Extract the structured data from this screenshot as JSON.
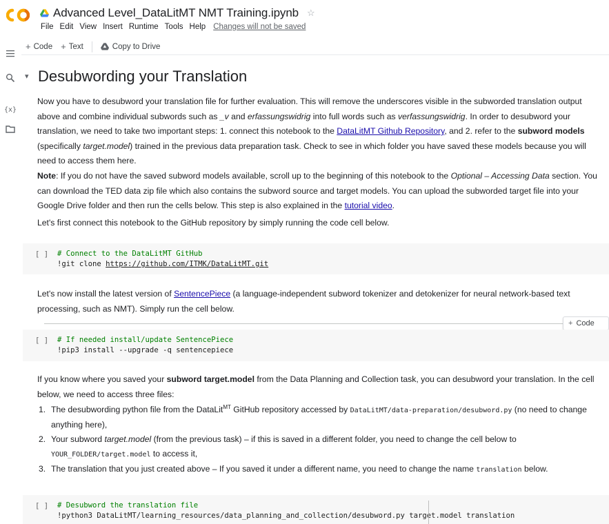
{
  "header": {
    "title": "Advanced Level_DataLitMT NMT Training.ipynb",
    "menu": [
      "File",
      "Edit",
      "View",
      "Insert",
      "Runtime",
      "Tools",
      "Help"
    ],
    "unsaved_notice": "Changes will not be saved"
  },
  "toolbar": {
    "add_code": "Code",
    "add_text": "Text",
    "copy_to_drive": "Copy to Drive"
  },
  "sidebar_icons": [
    "table-of-contents-icon",
    "search-icon",
    "variables-icon",
    "files-icon"
  ],
  "section": {
    "heading": "Desubwording your Translation",
    "para1": {
      "t1": "Now you have to desubword your translation file for further evaluation. This will remove the underscores visible in the subworded translation output above and combine individual subwords such as ",
      "em1": "_v",
      "t2": " and ",
      "em2": "erfassungswidrig",
      "t3": " into full words such as ",
      "em3": "verfassungswidrig",
      "t4": ". In order to desubword your translation, we need to take two important steps: 1. connect this notebook to the ",
      "link": "DataLitMT Github Repository",
      "t5": ", and 2. refer to the ",
      "b1": "subword models",
      "t6": " (specifically ",
      "em4": "target.model",
      "t7": ") trained in the previous data preparation task. Check to see in which folder you have saved these models because you will need to access them here."
    },
    "para2": {
      "b1": "Note",
      "t1": ": If you do not have the saved subword models available, scroll up to the beginning of this notebook to the ",
      "em1": "Optional – Accessing Data",
      "t2": " section. You can download the TED data zip file which also contains the subword source and target models. You can upload the subworded target file into your Google Drive folder and then run the cells below. This step is also explained in the ",
      "link": "tutorial video",
      "t3": "."
    },
    "para3": "Let's first connect this notebook to the GitHub repository by simply running the code cell below.",
    "cell1": {
      "run": "[ ]",
      "comment": "# Connect to the DataLitMT GitHub",
      "cmd": "!git clone ",
      "url": "https://github.com/ITMK/DataLitMT.git"
    },
    "para4": {
      "t1": "Let's now install the latest version of ",
      "link": "SentencePiece",
      "t2": " (a language-independent subword tokenizer and detokenizer for neural network-based text processing, such as NMT). Simply run the cell below."
    },
    "add_code_hover": "Code",
    "cell2": {
      "run": "[ ]",
      "comment": "# If needed install/update SentencePiece",
      "cmd": "!pip3 install --upgrade -q sentencepiece"
    },
    "para5": {
      "t1": "If you know where you saved your ",
      "b1": "subword target.model",
      "t2": " from the Data Planning and Collection task, you can desubword your translation. In the cell below, we need to access three files:"
    },
    "list": {
      "i1_n": "1.",
      "i1_t1": "The desubwording python file from the DataLit",
      "i1_sup": "MT",
      "i1_t2": " GitHub repository accessed by ",
      "i1_code": "DataLitMT/data-preparation/desubword.py",
      "i1_t3": " (no need to change anything here),",
      "i2_n": "2.",
      "i2_t1": "Your subword ",
      "i2_em": "target.model",
      "i2_t2": " (from the previous task) – if this is saved in a different folder, you need to change the cell below to ",
      "i2_code": "YOUR_FOLDER/target.model",
      "i2_t3": " to access it,",
      "i3_n": "3.",
      "i3_t1": "The translation that you just created above – If you saved it under a different name, you need to change the name ",
      "i3_code": "translation",
      "i3_t2": " below."
    },
    "cell3": {
      "run": "[ ]",
      "comment": "# Desubword the translation file",
      "cmd": "!python3 DataLitMT/learning_resources/data_planning_and_collection/desubword.py target.model translation"
    }
  },
  "colors": {
    "link": "#1a0dab",
    "comment": "#008000",
    "cell_bg": "#f7f7f7",
    "logo_orange": "#f9ab00"
  }
}
